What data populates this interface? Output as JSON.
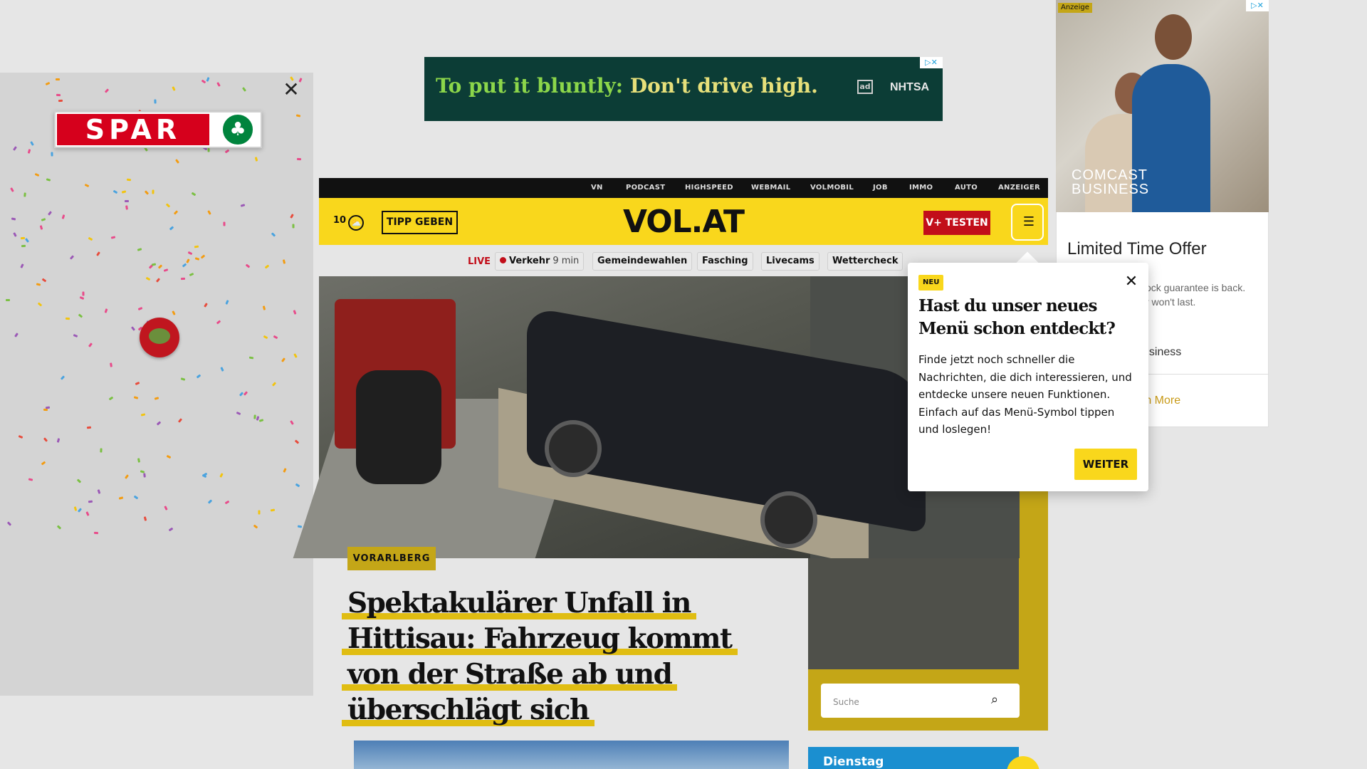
{
  "skin_ad": {
    "close_glyph": "✕",
    "brand": "SPAR",
    "tree_glyph": "♣",
    "colors": {
      "brand_red": "#d6001c",
      "brand_green": "#00843d"
    }
  },
  "top_banner": {
    "text_part1": "To put it bluntly:",
    "text_part2": "Don't drive high.",
    "ad_mark": "ad",
    "sponsor": "NHTSA",
    "adchoices": "▷✕"
  },
  "top_nav": {
    "items": [
      "VN",
      "PODCAST",
      "HIGHSPEED",
      "WEBMAIL",
      "VOLMOBIL",
      "JOB",
      "IMMO",
      "AUTO",
      "ANZEIGER"
    ]
  },
  "header": {
    "weather_temp": "10",
    "weather_icon": "cloud-sun-icon",
    "tipp_label": "TIPP GEBEN",
    "logo": "VOL.AT",
    "vplus_label": "V+ TESTEN",
    "menu_glyph": "☰"
  },
  "subnav": {
    "live_label": "LIVE",
    "verkehr_label": "Verkehr",
    "verkehr_time": "9 min",
    "pills": [
      "Gemeindewahlen",
      "Fasching",
      "Livecams",
      "Wettercheck"
    ]
  },
  "article": {
    "category": "VORARLBERG",
    "headline": "Spektakulärer Unfall in Hittisau: Fahrzeug kommt von der Straße ab und überschlägt sich"
  },
  "search": {
    "placeholder": "Suche",
    "icon_glyph": "⌕"
  },
  "weather_card": {
    "day": "Dienstag"
  },
  "right_ad": {
    "anzeige": "Anzeige",
    "adchoices": "▷✕",
    "brand_line1": "COMCAST",
    "brand_line2": "BUSINESS",
    "title": "Limited Time Offer",
    "subtitle_line1": "ock guarantee is back.",
    "subtitle_line2": "r won't last.",
    "brand_text": "usiness",
    "cta": "rn More"
  },
  "popup": {
    "badge": "NEU",
    "close_glyph": "✕",
    "title": "Hast du unser neues Menü schon entdeckt?",
    "body": "Finde jetzt noch schneller die Nachrichten, die dich interessieren, und entdecke unsere neuen Funktionen. Einfach auf das Menü-Symbol tippen und loslegen!",
    "button": "WEITER"
  },
  "colors": {
    "accent_yellow": "#f9d71c",
    "dark_yellow": "#c4a617",
    "vplus_red": "#c20e1a",
    "link_blue": "#1b8fd0"
  }
}
